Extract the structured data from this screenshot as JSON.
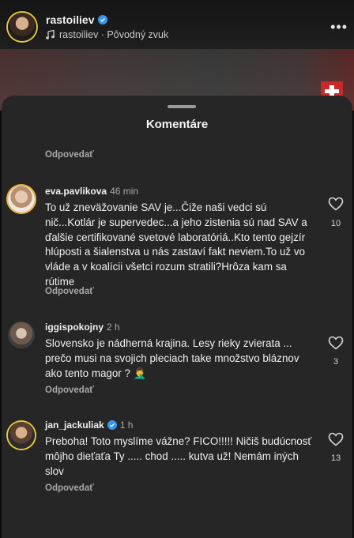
{
  "reel": {
    "username": "rastoiliev",
    "audio": "rastoiliev · Pôvodný zvuk"
  },
  "sheet": {
    "title": "Komentáre",
    "top_reply_label": "Odpovedať"
  },
  "comments": [
    {
      "username": "eva.pavlikova",
      "verified": false,
      "time": "46 min",
      "text": "To už zneväžovanie SAV je...Čiže naši vedci sú nič...Kotlár je supervedec...a jeho zistenia sú nad SAV a ďalšie certifikované svetové laboratóriá..Kto tento gejzír hlúposti a šialenstva u nás zastaví fakt neviem.To už vo vláde a v koalícii všetci rozum stratili?Hrôza kam sa rútime",
      "likes": "10",
      "reply_label": "Odpovedať"
    },
    {
      "username": "iggispokojny",
      "verified": false,
      "time": "2 h",
      "text": "Slovensko je nádherná krajina. Lesy rieky zvierata ... prečo musi na svojich pleciach take množstvo bláznov ako tento magor ? 🤦‍♂️",
      "likes": "3",
      "reply_label": "Odpovedať"
    },
    {
      "username": "jan_jackuliak",
      "verified": true,
      "time": "1 h",
      "text": "Preboha! Toto myslíme vážne? FICO!!!!! Ničiš budúcnosť môjho dieťaťa Ty ..... chod ..... kutva už! Nemám iných slov",
      "likes": "13",
      "reply_label": "Odpovedať"
    }
  ],
  "icons": {
    "verified": "verified-badge-icon",
    "music": "music-note-icon",
    "like": "heart-icon",
    "more": "more-icon"
  },
  "colors": {
    "sheet_bg": "#262626",
    "verified_blue": "#3797f0",
    "muted_text": "#a8a8a8"
  }
}
